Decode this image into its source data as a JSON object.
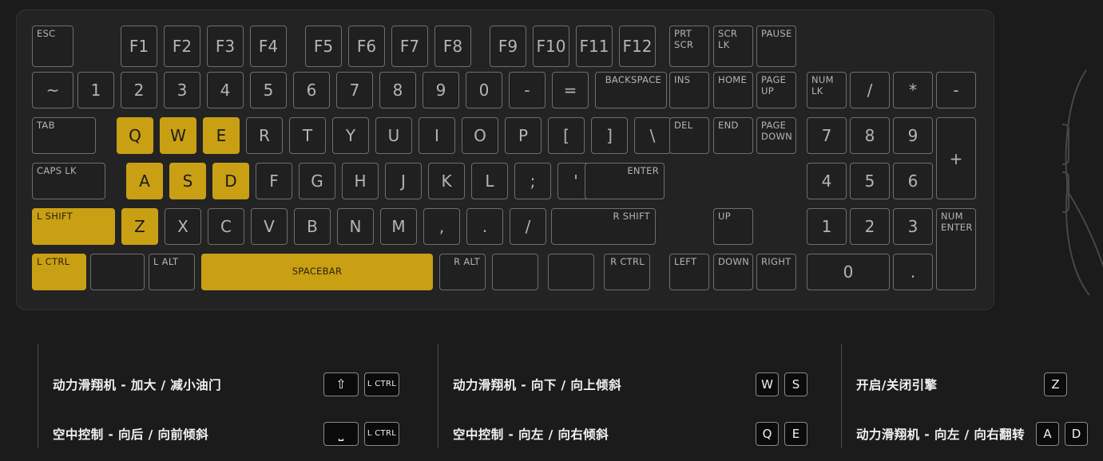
{
  "keyboard": {
    "rows": {
      "function_row": [
        {
          "label": "ESC",
          "style": "small tl"
        },
        {
          "label": "F1"
        },
        {
          "label": "F2"
        },
        {
          "label": "F3"
        },
        {
          "label": "F4"
        },
        {
          "label": "F5"
        },
        {
          "label": "F6"
        },
        {
          "label": "F7"
        },
        {
          "label": "F8"
        },
        {
          "label": "F9"
        },
        {
          "label": "F10"
        },
        {
          "label": "F11"
        },
        {
          "label": "F12"
        },
        {
          "label": "PRT SCR",
          "style": "small tl"
        },
        {
          "label": "SCR LK",
          "style": "small tl"
        },
        {
          "label": "PAUSE",
          "style": "small tl"
        }
      ],
      "number_row": [
        {
          "label": "~"
        },
        {
          "label": "1"
        },
        {
          "label": "2"
        },
        {
          "label": "3"
        },
        {
          "label": "4"
        },
        {
          "label": "5"
        },
        {
          "label": "6"
        },
        {
          "label": "7"
        },
        {
          "label": "8"
        },
        {
          "label": "9"
        },
        {
          "label": "0"
        },
        {
          "label": "-"
        },
        {
          "label": "="
        },
        {
          "label": "BACKSPACE",
          "style": "small tr"
        },
        {
          "label": "INS",
          "style": "small tl"
        },
        {
          "label": "HOME",
          "style": "small tl"
        },
        {
          "label": "PAGE UP",
          "style": "small tl"
        },
        {
          "label": "NUM LK",
          "style": "small tl"
        },
        {
          "label": "/"
        },
        {
          "label": "*"
        },
        {
          "label": "-"
        }
      ],
      "top_row": [
        {
          "label": "TAB",
          "style": "small tl"
        },
        {
          "label": "Q",
          "highlighted": true
        },
        {
          "label": "W",
          "highlighted": true
        },
        {
          "label": "E",
          "highlighted": true
        },
        {
          "label": "R"
        },
        {
          "label": "T"
        },
        {
          "label": "Y"
        },
        {
          "label": "U"
        },
        {
          "label": "I"
        },
        {
          "label": "O"
        },
        {
          "label": "P"
        },
        {
          "label": "["
        },
        {
          "label": "]"
        },
        {
          "label": "\\"
        },
        {
          "label": "DEL",
          "style": "small tl"
        },
        {
          "label": "END",
          "style": "small tl"
        },
        {
          "label": "PAGE DOWN",
          "style": "small tl"
        },
        {
          "label": "7"
        },
        {
          "label": "8"
        },
        {
          "label": "9"
        },
        {
          "label": "+"
        }
      ],
      "home_row": [
        {
          "label": "CAPS LK",
          "style": "small tl"
        },
        {
          "label": "A",
          "highlighted": true
        },
        {
          "label": "S",
          "highlighted": true
        },
        {
          "label": "D",
          "highlighted": true
        },
        {
          "label": "F"
        },
        {
          "label": "G"
        },
        {
          "label": "H"
        },
        {
          "label": "J"
        },
        {
          "label": "K"
        },
        {
          "label": "L"
        },
        {
          "label": ";"
        },
        {
          "label": "'"
        },
        {
          "label": "ENTER",
          "style": "small tr"
        },
        {
          "label": "4"
        },
        {
          "label": "5"
        },
        {
          "label": "6"
        }
      ],
      "bottom_row": [
        {
          "label": "L SHIFT",
          "style": "small tl",
          "highlighted": true
        },
        {
          "label": "Z",
          "highlighted": true
        },
        {
          "label": "X"
        },
        {
          "label": "C"
        },
        {
          "label": "V"
        },
        {
          "label": "B"
        },
        {
          "label": "N"
        },
        {
          "label": "M"
        },
        {
          "label": ","
        },
        {
          "label": "."
        },
        {
          "label": "/"
        },
        {
          "label": "R SHIFT",
          "style": "small tr"
        },
        {
          "label": "UP",
          "style": "small tl"
        },
        {
          "label": "1"
        },
        {
          "label": "2"
        },
        {
          "label": "3"
        },
        {
          "label": "NUM ENTER",
          "style": "small tl"
        }
      ],
      "modifier_row": [
        {
          "label": "L CTRL",
          "style": "small tl",
          "highlighted": true
        },
        {
          "label": "",
          "style": "small tl"
        },
        {
          "label": "L ALT",
          "style": "small tl"
        },
        {
          "label": "SPACEBAR",
          "style": "small",
          "highlighted": true
        },
        {
          "label": "R ALT",
          "style": "small tr"
        },
        {
          "label": "",
          "style": "small tl"
        },
        {
          "label": "",
          "style": "small tl"
        },
        {
          "label": "R CTRL",
          "style": "small tr"
        },
        {
          "label": "LEFT",
          "style": "small tl"
        },
        {
          "label": "DOWN",
          "style": "small tl"
        },
        {
          "label": "RIGHT",
          "style": "small tl"
        },
        {
          "label": "0"
        },
        {
          "label": "."
        }
      ]
    },
    "key_labels": {
      "esc": "ESC",
      "f1": "F1",
      "f2": "F2",
      "f3": "F3",
      "f4": "F4",
      "f5": "F5",
      "f6": "F6",
      "f7": "F7",
      "f8": "F8",
      "f9": "F9",
      "f10": "F10",
      "f11": "F11",
      "f12": "F12",
      "prt_scr_1": "PRT",
      "prt_scr_2": "SCR",
      "scr_lk_1": "SCR",
      "scr_lk_2": "LK",
      "pause": "PAUSE",
      "tilde": "~",
      "n1": "1",
      "n2": "2",
      "n3": "3",
      "n4": "4",
      "n5": "5",
      "n6": "6",
      "n7": "7",
      "n8": "8",
      "n9": "9",
      "n0": "0",
      "minus": "-",
      "equals": "=",
      "backspace": "BACKSPACE",
      "ins": "INS",
      "home": "HOME",
      "page_up_1": "PAGE",
      "page_up_2": "UP",
      "num_lk_1": "NUM",
      "num_lk_2": "LK",
      "np_divide": "/",
      "np_multiply": "*",
      "np_minus": "-",
      "tab": "TAB",
      "q": "Q",
      "w": "W",
      "e": "E",
      "r": "R",
      "t": "T",
      "y": "Y",
      "u": "U",
      "i": "I",
      "o": "O",
      "p": "P",
      "bracket_left": "[",
      "bracket_right": "]",
      "backslash": "\\",
      "del": "DEL",
      "end": "END",
      "page_down_1": "PAGE",
      "page_down_2": "DOWN",
      "np7": "7",
      "np8": "8",
      "np9": "9",
      "np_plus": "+",
      "caps_lk": "CAPS LK",
      "a": "A",
      "s": "S",
      "d": "D",
      "f": "F",
      "g": "G",
      "h": "H",
      "j": "J",
      "k": "K",
      "l": "L",
      "semicolon": ";",
      "quote": "'",
      "enter": "ENTER",
      "np4": "4",
      "np5": "5",
      "np6": "6",
      "l_shift": "L SHIFT",
      "z": "Z",
      "x": "X",
      "c": "C",
      "v": "V",
      "b": "B",
      "n": "N",
      "m": "M",
      "comma": ",",
      "period": ".",
      "slash": "/",
      "r_shift": "R SHIFT",
      "up": "UP",
      "np1": "1",
      "np2": "2",
      "np3": "3",
      "num_enter_1": "NUM",
      "num_enter_2": "ENTER",
      "l_ctrl": "L CTRL",
      "l_win": "",
      "l_alt": "L ALT",
      "spacebar": "SPACEBAR",
      "r_alt": "R ALT",
      "r_win": "",
      "menu": "",
      "r_ctrl": "R CTRL",
      "left": "LEFT",
      "down": "DOWN",
      "right": "RIGHT",
      "np0": "0",
      "np_period": "."
    }
  },
  "legend": {
    "columns": [
      {
        "rows": [
          {
            "label": "动力滑翔机 - 加大 / 减小油门",
            "keys": [
              {
                "glyph": "⇧",
                "type": "glyph",
                "width": "wide"
              },
              {
                "glyph": "L CTRL",
                "type": "tiny",
                "width": "wide"
              }
            ]
          },
          {
            "label": "空中控制 - 向后 / 向前倾斜",
            "keys": [
              {
                "glyph": "⎵",
                "type": "glyph",
                "width": "wide"
              },
              {
                "glyph": "L CTRL",
                "type": "tiny",
                "width": "wide"
              }
            ]
          }
        ]
      },
      {
        "rows": [
          {
            "label": "动力滑翔机 - 向下 / 向上倾斜",
            "keys": [
              {
                "glyph": "W",
                "type": "letter",
                "width": "normal"
              },
              {
                "glyph": "S",
                "type": "letter",
                "width": "normal"
              }
            ]
          },
          {
            "label": "空中控制 - 向左 / 向右倾斜",
            "keys": [
              {
                "glyph": "Q",
                "type": "letter",
                "width": "normal"
              },
              {
                "glyph": "E",
                "type": "letter",
                "width": "normal"
              }
            ]
          }
        ]
      },
      {
        "rows": [
          {
            "label": "开启/关闭引擎",
            "keys": [
              {
                "glyph": "Z",
                "type": "letter",
                "width": "normal"
              }
            ]
          },
          {
            "label": "动力滑翔机 - 向左 / 向右翻转",
            "keys": [
              {
                "glyph": "A",
                "type": "letter",
                "width": "normal"
              },
              {
                "glyph": "D",
                "type": "letter",
                "width": "normal"
              }
            ]
          }
        ]
      }
    ]
  },
  "colors": {
    "page_background": "#1b1b1b",
    "panel_background": "#232323",
    "panel_border": "#333333",
    "key_background": "#202020",
    "key_border": "#6e6e6e",
    "key_text": "#b4b4b4",
    "highlight": "#c9a014",
    "highlight_text": "#1a1a1a",
    "legend_text": "#f2f2f2",
    "legend_divider": "#4a4a4a",
    "chip_background": "#0b0b0b",
    "chip_border": "#8a8a8a"
  }
}
